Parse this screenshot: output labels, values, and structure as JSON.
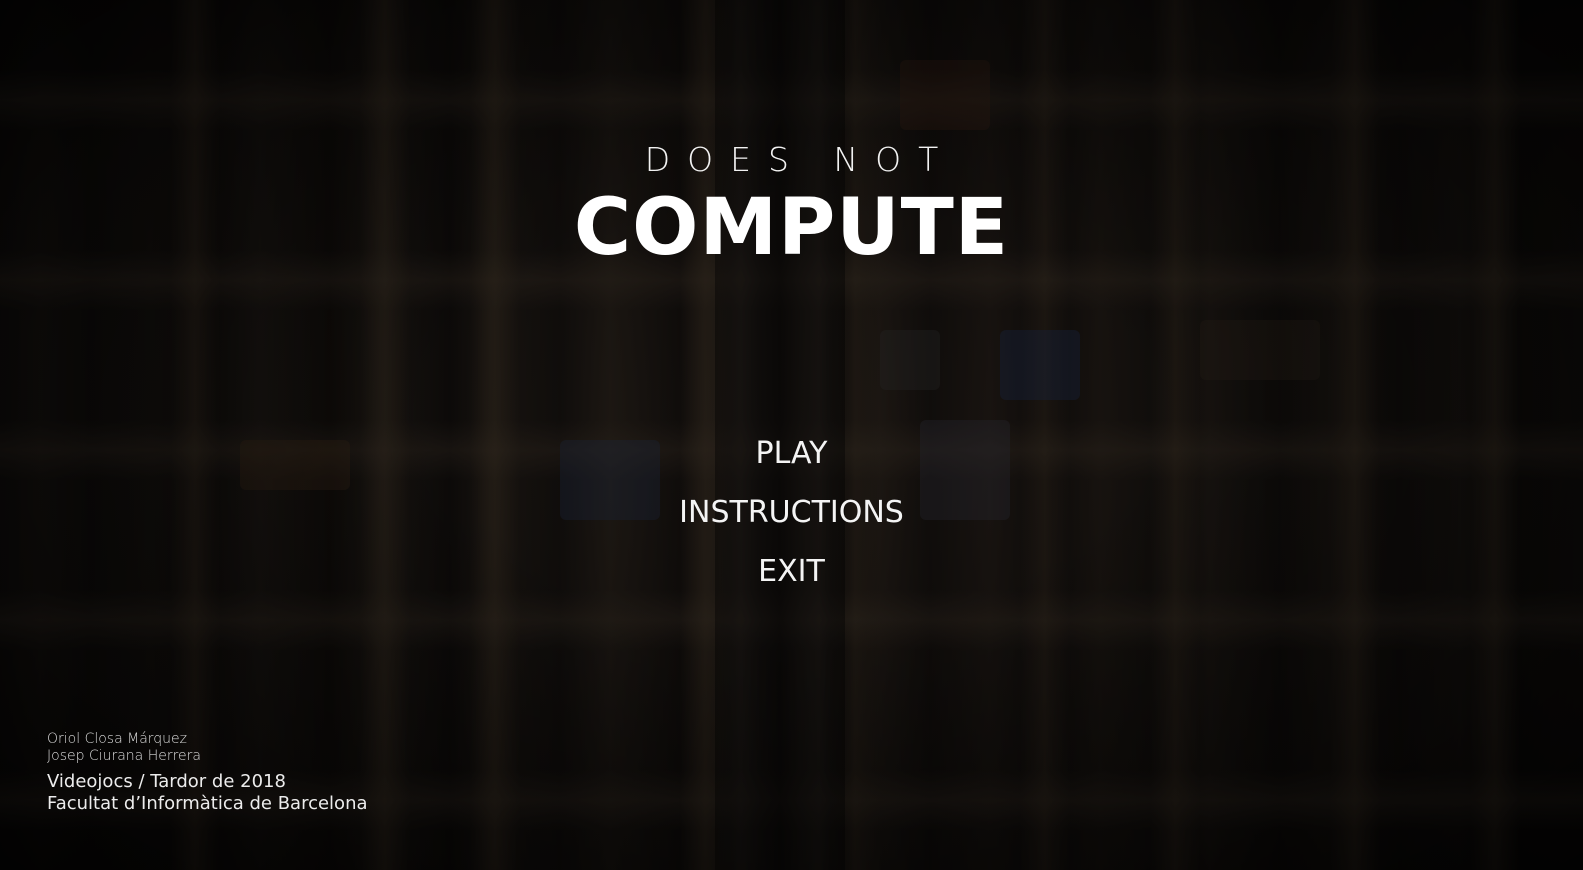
{
  "title": {
    "top": "DOES NOT",
    "main": "COMPUTE"
  },
  "menu": {
    "items": [
      {
        "label": "PLAY"
      },
      {
        "label": "INSTRUCTIONS"
      },
      {
        "label": "EXIT"
      }
    ]
  },
  "credits": {
    "authors": [
      "Oriol Closa Márquez",
      "Josep Ciurana Herrera"
    ],
    "course": "Videojocs / Tardor de 2018",
    "school": "Facultat d’Informàtica de Barcelona"
  },
  "colors": {
    "text": "#ffffff",
    "background": "#1a1715"
  }
}
